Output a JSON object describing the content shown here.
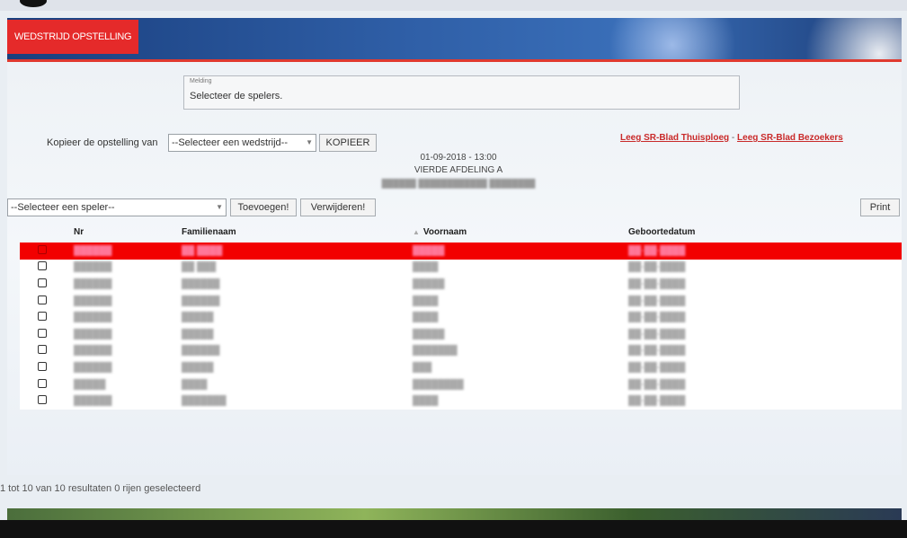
{
  "header": {
    "tab_label": "WEDSTRIJD OPSTELLING"
  },
  "melding": {
    "label": "Melding",
    "message": "Selecteer de spelers."
  },
  "kopieer": {
    "label": "Kopieer de opstelling van",
    "select_value": "--Selecteer een wedstrijd--",
    "button": "KOPIEER"
  },
  "links": {
    "thuis": "Leeg SR-Blad Thuisploeg",
    "sep": "-",
    "bezoekers": "Leeg SR-Blad Bezoekers"
  },
  "match": {
    "datetime": "01-09-2018 - 13:00",
    "division": "VIERDE AFDELING A",
    "teams": "██████ ████████████ ████████"
  },
  "player_bar": {
    "select_value": "--Selecteer een speler--",
    "add_button": "Toevoegen!",
    "remove_button": "Verwijderen!",
    "print_button": "Print"
  },
  "table": {
    "columns": [
      "Nr",
      "Familienaam",
      "Voornaam",
      "Geboortedatum"
    ],
    "rows": [
      {
        "nr": "██████",
        "familienaam": "██ ████",
        "voornaam": "█████",
        "geboortedatum": "██-██-████"
      },
      {
        "nr": "██████",
        "familienaam": "██ ███",
        "voornaam": "████",
        "geboortedatum": "██-██-████"
      },
      {
        "nr": "██████",
        "familienaam": "██████",
        "voornaam": "█████",
        "geboortedatum": "██-██-████"
      },
      {
        "nr": "██████",
        "familienaam": "██████",
        "voornaam": "████",
        "geboortedatum": "██-██-████"
      },
      {
        "nr": "██████",
        "familienaam": "█████",
        "voornaam": "████",
        "geboortedatum": "██-██-████"
      },
      {
        "nr": "██████",
        "familienaam": "█████",
        "voornaam": "█████",
        "geboortedatum": "██-██-████"
      },
      {
        "nr": "██████",
        "familienaam": "██████",
        "voornaam": "███████",
        "geboortedatum": "██-██-████"
      },
      {
        "nr": "██████",
        "familienaam": "█████",
        "voornaam": "███",
        "geboortedatum": "██-██-████"
      },
      {
        "nr": "█████",
        "familienaam": "████",
        "voornaam": "████████",
        "geboortedatum": "██-██-████"
      },
      {
        "nr": "██████",
        "familienaam": "███████",
        "voornaam": "████",
        "geboortedatum": "██-██-████"
      }
    ]
  },
  "footer": {
    "summary": "1 tot 10 van 10 resultaten  0 rijen geselecteerd"
  },
  "colors": {
    "accent_red": "#e52a2a",
    "selected_row": "#f20000",
    "banner_blue": "#2f5fa7"
  }
}
